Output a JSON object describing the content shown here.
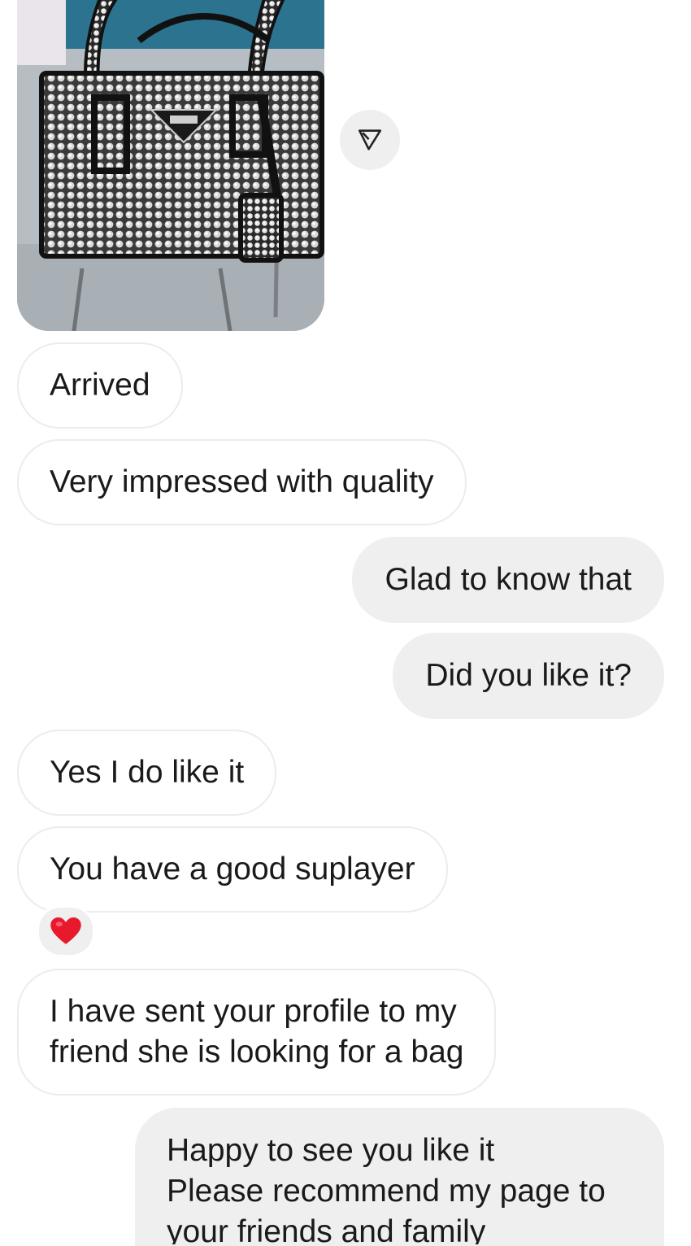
{
  "messages": {
    "photo": {
      "description_icon": "handbag-photo",
      "share_icon": "send-arrow-icon"
    },
    "m1": {
      "text": "Arrived",
      "direction": "incoming"
    },
    "m2": {
      "text": "Very impressed with quality",
      "direction": "incoming"
    },
    "m3": {
      "text": "Glad to know that",
      "direction": "outgoing"
    },
    "m4": {
      "text": "Did you like it?",
      "direction": "outgoing"
    },
    "m5": {
      "text": "Yes I do like it",
      "direction": "incoming"
    },
    "m6": {
      "text": "You have a good suplayer",
      "direction": "incoming",
      "reaction": "heart-icon"
    },
    "m7": {
      "line1": "I have sent your profile to my",
      "line2": "friend she is looking for a bag",
      "direction": "incoming"
    },
    "m8": {
      "line1": "Happy to see you like it",
      "line2": "Please recommend my page to",
      "line3": "your friends and family",
      "direction": "outgoing"
    }
  },
  "colors": {
    "outgoing_bubble": "#efefef",
    "incoming_border": "#ececec",
    "reaction_heart": "#e8192c"
  }
}
